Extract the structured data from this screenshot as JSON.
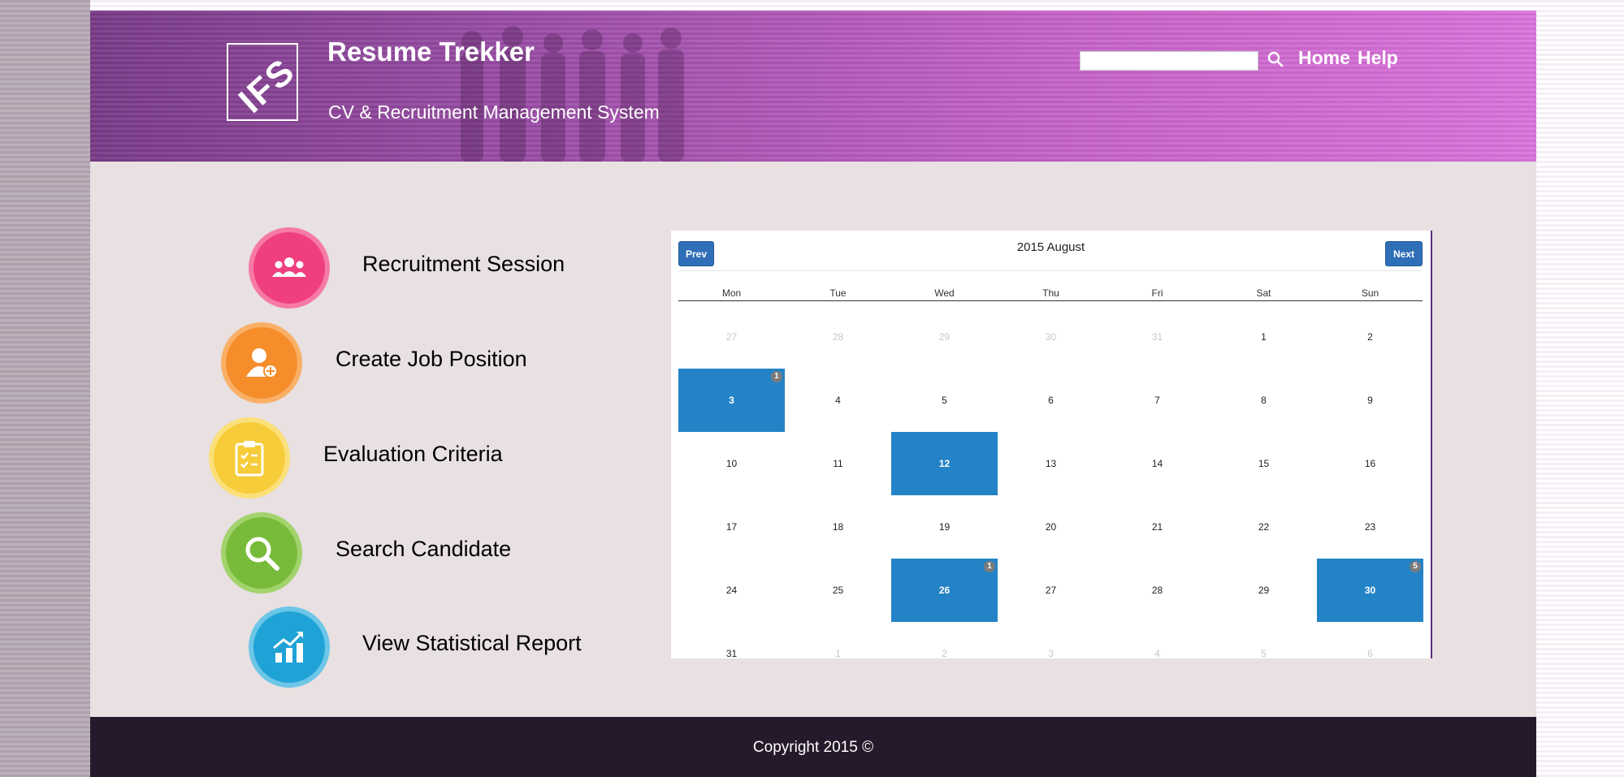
{
  "header": {
    "logo_text": "IFS",
    "app_title": "Resume Trekker",
    "subtitle": "CV & Recruitment Management System",
    "search": {
      "value": "",
      "placeholder": "",
      "icon": "search-icon"
    },
    "nav": [
      {
        "label": "Home"
      },
      {
        "label": "Help"
      }
    ]
  },
  "menu": [
    {
      "label": "Recruitment Session",
      "icon": "people-group-icon",
      "color": "#ef3f7e"
    },
    {
      "label": "Create Job Position",
      "icon": "add-user-icon",
      "color": "#f68d2b"
    },
    {
      "label": "Evaluation Criteria",
      "icon": "clipboard-checklist-icon",
      "color": "#f7cc3a"
    },
    {
      "label": "Search Candidate",
      "icon": "magnifier-icon",
      "color": "#78bb3a"
    },
    {
      "label": "View Statistical Report",
      "icon": "bar-chart-growth-icon",
      "color": "#1fa3d6"
    }
  ],
  "calendar": {
    "title": "2015 August",
    "prev_label": "Prev",
    "next_label": "Next",
    "weekdays": [
      "Mon",
      "Tue",
      "Wed",
      "Thu",
      "Fri",
      "Sat",
      "Sun"
    ],
    "event_color": "#2483c7",
    "weeks": [
      [
        {
          "day": "27",
          "muted": true
        },
        {
          "day": "28",
          "muted": true
        },
        {
          "day": "29",
          "muted": true
        },
        {
          "day": "30",
          "muted": true
        },
        {
          "day": "31",
          "muted": true
        },
        {
          "day": "1"
        },
        {
          "day": "2"
        }
      ],
      [
        {
          "day": "3",
          "event": true,
          "badge": "1"
        },
        {
          "day": "4"
        },
        {
          "day": "5"
        },
        {
          "day": "6"
        },
        {
          "day": "7"
        },
        {
          "day": "8"
        },
        {
          "day": "9"
        }
      ],
      [
        {
          "day": "10"
        },
        {
          "day": "11"
        },
        {
          "day": "12",
          "event": true
        },
        {
          "day": "13"
        },
        {
          "day": "14"
        },
        {
          "day": "15"
        },
        {
          "day": "16"
        }
      ],
      [
        {
          "day": "17"
        },
        {
          "day": "18"
        },
        {
          "day": "19"
        },
        {
          "day": "20"
        },
        {
          "day": "21"
        },
        {
          "day": "22"
        },
        {
          "day": "23"
        }
      ],
      [
        {
          "day": "24"
        },
        {
          "day": "25"
        },
        {
          "day": "26",
          "event": true,
          "badge": "1"
        },
        {
          "day": "27"
        },
        {
          "day": "28"
        },
        {
          "day": "29"
        },
        {
          "day": "30",
          "event": true,
          "badge": "5"
        }
      ],
      [
        {
          "day": "31"
        },
        {
          "day": "1",
          "muted": true
        },
        {
          "day": "2",
          "muted": true
        },
        {
          "day": "3",
          "muted": true
        },
        {
          "day": "4",
          "muted": true
        },
        {
          "day": "5",
          "muted": true
        },
        {
          "day": "6",
          "muted": true
        }
      ]
    ]
  },
  "footer": {
    "copyright": "Copyright 2015 ©"
  }
}
